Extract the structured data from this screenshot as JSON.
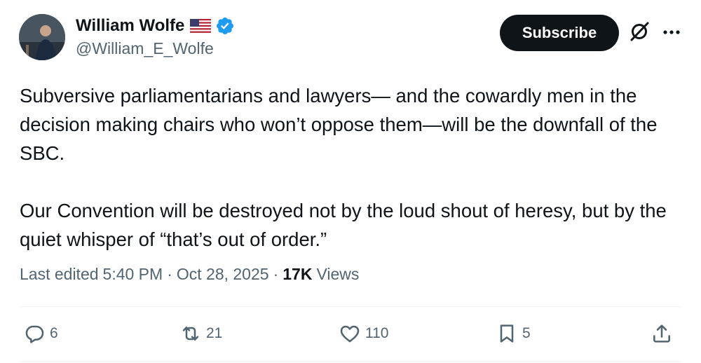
{
  "author": {
    "name": "William Wolfe",
    "handle": "@William_E_Wolfe",
    "flag_icon": "us-flag-icon",
    "verified_icon": "verified-badge-icon",
    "verified_color": "#1d9bf0"
  },
  "header": {
    "subscribe_label": "Subscribe",
    "grok_icon": "grok-icon",
    "more_icon": "more-options-icon"
  },
  "tweet": {
    "paragraphs": [
      "Subversive parliamentarians and lawyers— and the cowardly men in the decision making chairs who won’t oppose them—will be the downfall of the SBC.",
      "Our Convention will be destroyed not by the loud shout of heresy, but by the quiet whisper of “that’s out of order.”"
    ]
  },
  "meta": {
    "edited_label": "Last edited",
    "time": "5:40 PM",
    "date": "Oct 28, 2025",
    "views_count": "17K",
    "views_label": "Views"
  },
  "actions": {
    "replies": "6",
    "reposts": "21",
    "likes": "110",
    "bookmarks": "5"
  },
  "colors": {
    "text": "#0f1419",
    "secondary": "#536471",
    "subscribe_bg": "#0f1419"
  }
}
